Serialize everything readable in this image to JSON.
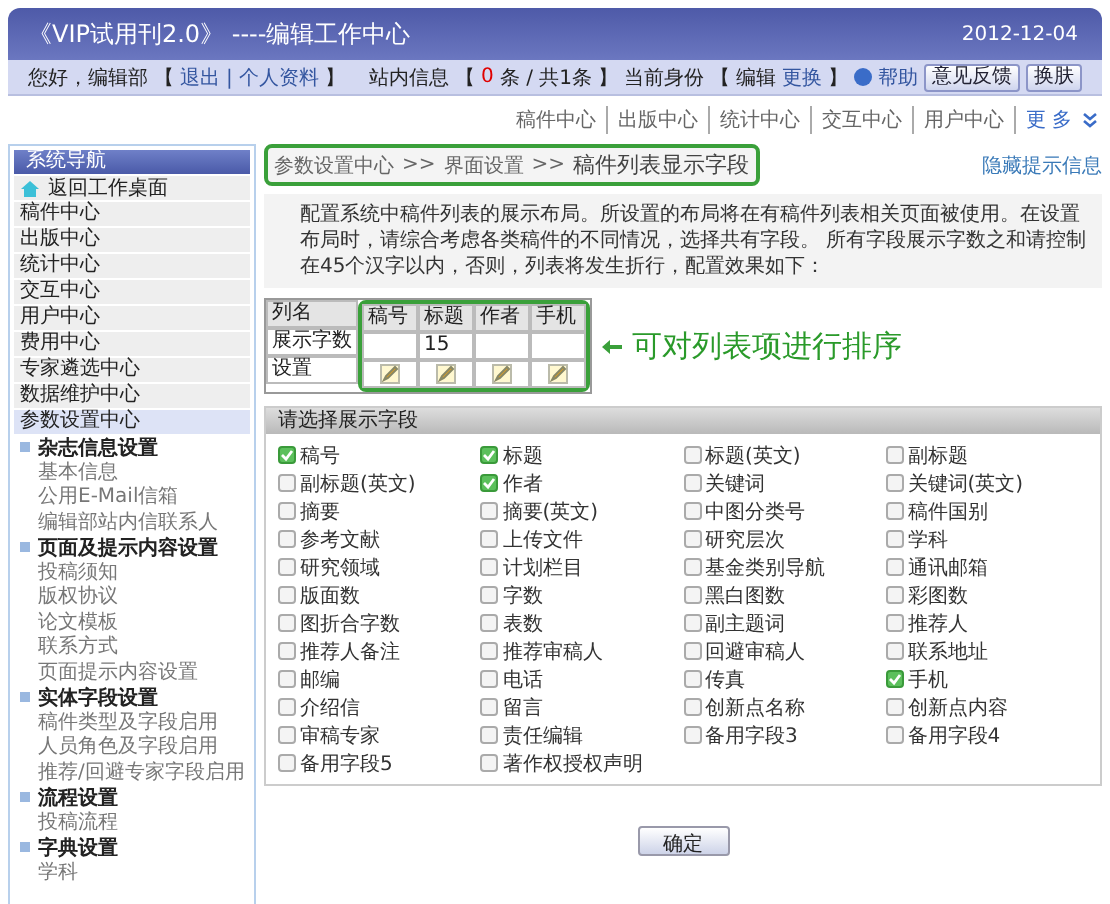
{
  "header": {
    "title": "《VIP试用刊2.0》 ----编辑工作中心",
    "date": "2012-12-04"
  },
  "user_bar": {
    "left": [
      {
        "kind": "text",
        "text": "您好，编辑部"
      },
      {
        "kind": "text",
        "text": "【"
      },
      {
        "kind": "link",
        "text": "退出"
      },
      {
        "kind": "link",
        "text": "| 个人资料"
      },
      {
        "kind": "text",
        "text": "】"
      }
    ],
    "right": [
      {
        "kind": "text",
        "text": "站内信息"
      },
      {
        "kind": "text",
        "text": "【"
      },
      {
        "kind": "count",
        "text": "0"
      },
      {
        "kind": "text",
        "text": "条 / 共1条"
      },
      {
        "kind": "text",
        "text": "】"
      },
      {
        "kind": "text",
        "text": "当前身份"
      },
      {
        "kind": "text",
        "text": "【"
      },
      {
        "kind": "text",
        "text": "编辑"
      },
      {
        "kind": "link",
        "text": "更换"
      },
      {
        "kind": "text",
        "text": "】"
      },
      {
        "kind": "help",
        "text": "帮助"
      },
      {
        "kind": "button",
        "text": "意见反馈"
      },
      {
        "kind": "button",
        "text": "换肤"
      }
    ]
  },
  "top_nav": {
    "items": [
      "稿件中心",
      "出版中心",
      "统计中心",
      "交互中心",
      "用户中心"
    ],
    "more": "更 多"
  },
  "sidebar": {
    "title": "系统导航",
    "home": "返回工作桌面",
    "items": [
      {
        "label": "稿件中心",
        "selected": false
      },
      {
        "label": "出版中心",
        "selected": false
      },
      {
        "label": "统计中心",
        "selected": false
      },
      {
        "label": "交互中心",
        "selected": false
      },
      {
        "label": "用户中心",
        "selected": false
      },
      {
        "label": "费用中心",
        "selected": false
      },
      {
        "label": "专家遴选中心",
        "selected": false
      },
      {
        "label": "数据维护中心",
        "selected": false
      },
      {
        "label": "参数设置中心",
        "selected": true
      }
    ],
    "tree": [
      {
        "label": "杂志信息设置",
        "children": [
          {
            "label": "基本信息"
          },
          {
            "label": "公用E-Mail信箱"
          },
          {
            "label": "编辑部站内信联系人"
          }
        ]
      },
      {
        "label": "页面及提示内容设置",
        "children": [
          {
            "label": "投稿须知"
          },
          {
            "label": "版权协议"
          },
          {
            "label": "论文模板"
          },
          {
            "label": "联系方式"
          },
          {
            "label": "页面提示内容设置"
          }
        ]
      },
      {
        "label": "实体字段设置",
        "children": [
          {
            "label": "稿件类型及字段启用"
          },
          {
            "label": "人员角色及字段启用"
          },
          {
            "label": "推荐/回避专家字段启用"
          }
        ]
      },
      {
        "label": "流程设置",
        "children": [
          {
            "label": "投稿流程"
          }
        ]
      },
      {
        "label": "字典设置",
        "children": [
          {
            "label": "学科"
          }
        ]
      }
    ]
  },
  "breadcrumb": {
    "items": [
      "参数设置中心",
      ">>",
      "界面设置",
      ">>"
    ],
    "current": "稿件列表显示字段",
    "hide_link": "隐藏提示信息"
  },
  "description": "配置系统中稿件列表的展示布局。所设置的布局将在有稿件列表相关页面被使用。在设置布局时，请综合考虑各类稿件的不同情况，选择共有字段。 所有字段展示字数之和请控制在45个汉字以内，否则，列表将发生折行，配置效果如下：",
  "preview_table": {
    "row_labels": [
      "列名",
      "展示字数",
      "设置"
    ],
    "columns": [
      {
        "name": "稿号"
      },
      {
        "name": "标题",
        "chars": "15"
      },
      {
        "name": "作者"
      },
      {
        "name": "手机"
      }
    ]
  },
  "annotation": "可对列表项进行排序",
  "fields_section": {
    "title": "请选择展示字段",
    "fields": [
      {
        "label": "稿号",
        "checked": true
      },
      {
        "label": "标题",
        "checked": true
      },
      {
        "label": "标题(英文)",
        "checked": false
      },
      {
        "label": "副标题",
        "checked": false
      },
      {
        "label": "副标题(英文)",
        "checked": false
      },
      {
        "label": "作者",
        "checked": true
      },
      {
        "label": "关键词",
        "checked": false
      },
      {
        "label": "关键词(英文)",
        "checked": false
      },
      {
        "label": "摘要",
        "checked": false
      },
      {
        "label": "摘要(英文)",
        "checked": false
      },
      {
        "label": "中图分类号",
        "checked": false
      },
      {
        "label": "稿件国别",
        "checked": false
      },
      {
        "label": "参考文献",
        "checked": false
      },
      {
        "label": "上传文件",
        "checked": false
      },
      {
        "label": "研究层次",
        "checked": false
      },
      {
        "label": "学科",
        "checked": false
      },
      {
        "label": "研究领域",
        "checked": false
      },
      {
        "label": "计划栏目",
        "checked": false
      },
      {
        "label": "基金类别导航",
        "checked": false
      },
      {
        "label": "通讯邮箱",
        "checked": false
      },
      {
        "label": "版面数",
        "checked": false
      },
      {
        "label": "字数",
        "checked": false
      },
      {
        "label": "黑白图数",
        "checked": false
      },
      {
        "label": "彩图数",
        "checked": false
      },
      {
        "label": "图折合字数",
        "checked": false
      },
      {
        "label": "表数",
        "checked": false
      },
      {
        "label": "副主题词",
        "checked": false
      },
      {
        "label": "推荐人",
        "checked": false
      },
      {
        "label": "推荐人备注",
        "checked": false
      },
      {
        "label": "推荐审稿人",
        "checked": false
      },
      {
        "label": "回避审稿人",
        "checked": false
      },
      {
        "label": "联系地址",
        "checked": false
      },
      {
        "label": "邮编",
        "checked": false
      },
      {
        "label": "电话",
        "checked": false
      },
      {
        "label": "传真",
        "checked": false
      },
      {
        "label": "手机",
        "checked": true
      },
      {
        "label": "介绍信",
        "checked": false
      },
      {
        "label": "留言",
        "checked": false
      },
      {
        "label": "创新点名称",
        "checked": false
      },
      {
        "label": "创新点内容",
        "checked": false
      },
      {
        "label": "审稿专家",
        "checked": false
      },
      {
        "label": "责任编辑",
        "checked": false
      },
      {
        "label": "备用字段3",
        "checked": false
      },
      {
        "label": "备用字段4",
        "checked": false
      },
      {
        "label": "备用字段5",
        "checked": false
      },
      {
        "label": "著作权授权声明",
        "checked": false
      }
    ]
  },
  "confirm_button": "确定"
}
